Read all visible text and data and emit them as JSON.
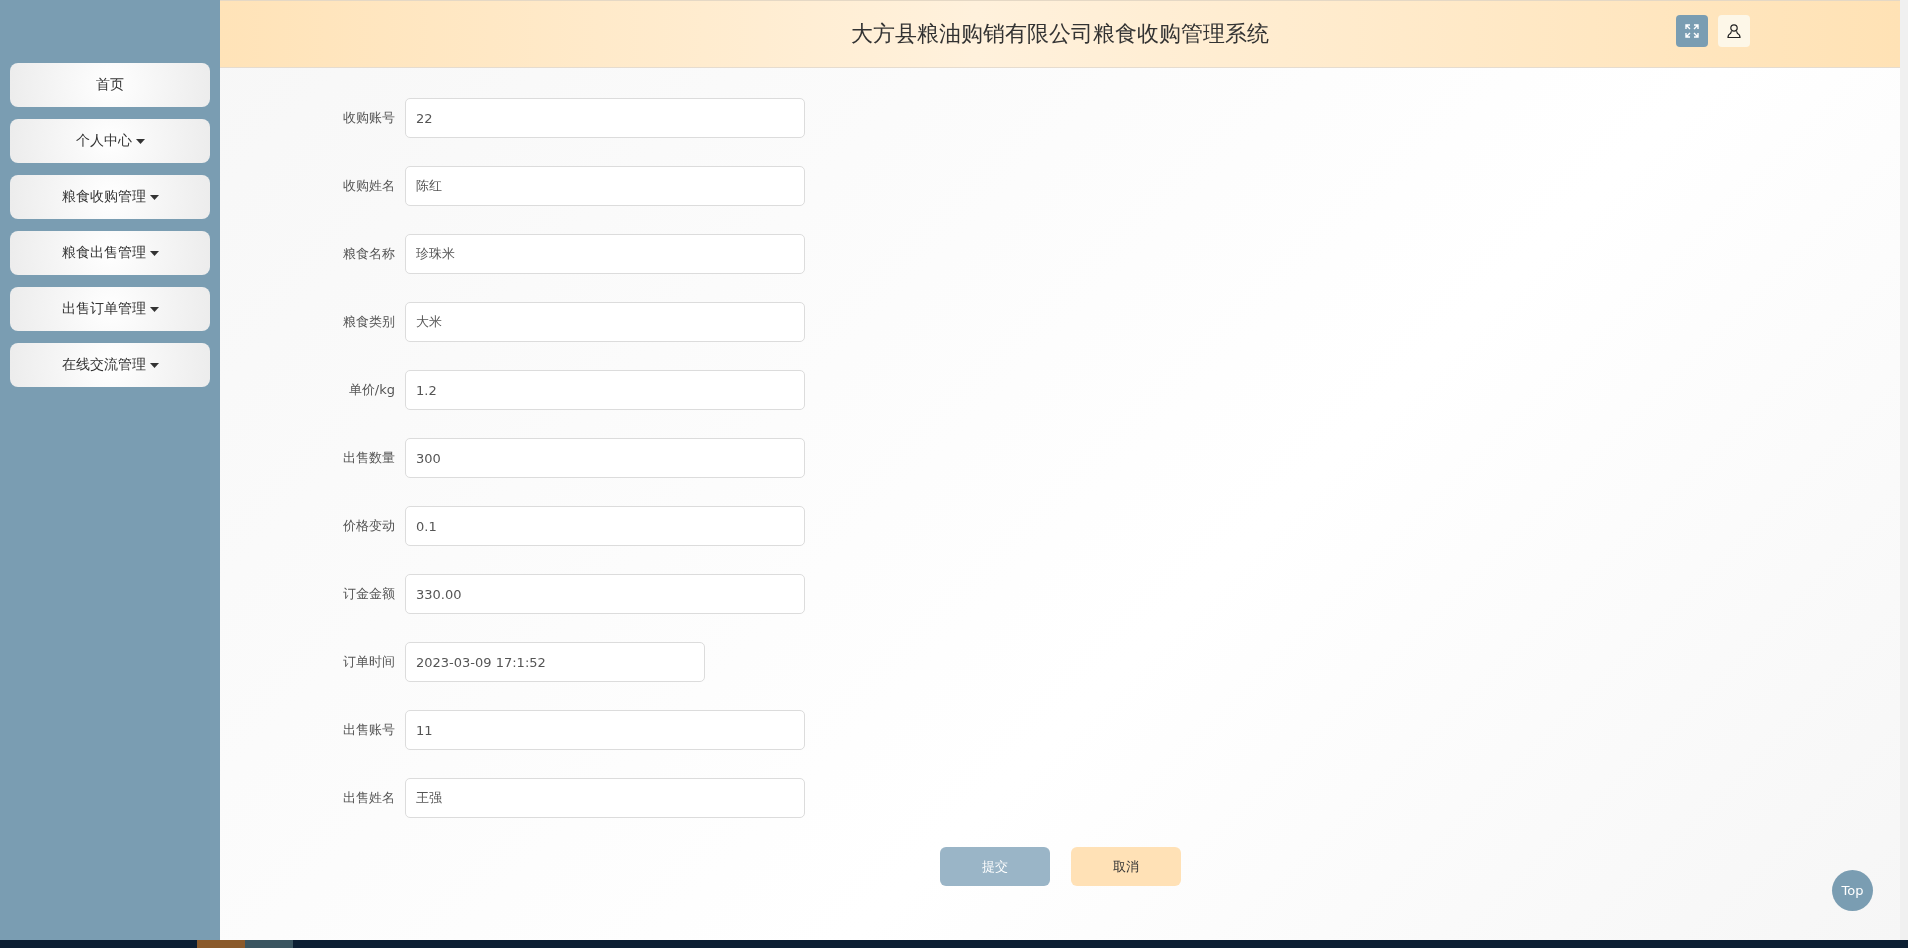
{
  "header": {
    "title": "大方县粮油购销有限公司粮食收购管理系统"
  },
  "sidebar": {
    "items": [
      {
        "label": "首页",
        "dropdown": false
      },
      {
        "label": "个人中心",
        "dropdown": true
      },
      {
        "label": "粮食收购管理",
        "dropdown": true
      },
      {
        "label": "粮食出售管理",
        "dropdown": true
      },
      {
        "label": "出售订单管理",
        "dropdown": true
      },
      {
        "label": "在线交流管理",
        "dropdown": true
      }
    ]
  },
  "form": {
    "fields": [
      {
        "label": "收购账号",
        "value": "22",
        "kind": "text"
      },
      {
        "label": "收购姓名",
        "value": "陈红",
        "kind": "text"
      },
      {
        "label": "粮食名称",
        "value": "珍珠米",
        "kind": "text"
      },
      {
        "label": "粮食类别",
        "value": "大米",
        "kind": "text"
      },
      {
        "label": "单价/kg",
        "value": "1.2",
        "kind": "text"
      },
      {
        "label": "出售数量",
        "value": "300",
        "kind": "text"
      },
      {
        "label": "价格变动",
        "value": "0.1",
        "kind": "text"
      },
      {
        "label": "订金金额",
        "value": "330.00",
        "kind": "text"
      },
      {
        "label": "订单时间",
        "value": "2023-03-09 17:1:52",
        "kind": "date"
      },
      {
        "label": "出售账号",
        "value": "11",
        "kind": "text"
      },
      {
        "label": "出售姓名",
        "value": "王强",
        "kind": "text"
      }
    ],
    "buttons": [
      {
        "label": "提交",
        "kind": "submit"
      },
      {
        "label": "取消",
        "kind": "cancel"
      }
    ]
  },
  "back_to_top": {
    "label": "Top"
  }
}
